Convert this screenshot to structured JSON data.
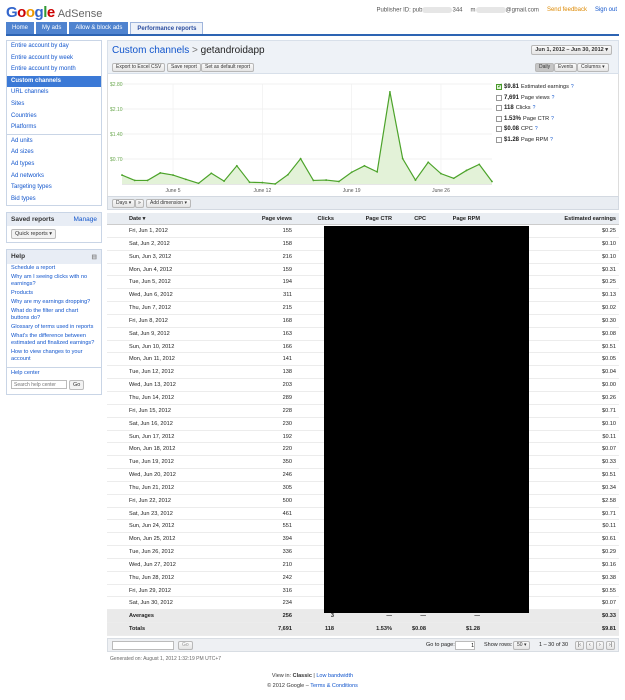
{
  "brand": {
    "g1": "G",
    "g2": "o",
    "g3": "o",
    "g4": "g",
    "g5": "l",
    "g6": "e",
    "product": "AdSense"
  },
  "header": {
    "publisher_label": "Publisher ID: pub",
    "publisher_tail": "344",
    "email_head": "m",
    "email_tail": "@gmail.com",
    "feedback": "Send feedback",
    "signout": "Sign out"
  },
  "nav": {
    "tabs": [
      "Home",
      "My ads",
      "Allow & block ads",
      "Performance reports"
    ]
  },
  "sidebar": {
    "items": [
      "Entire account by day",
      "Entire account by week",
      "Entire account by month",
      "Custom channels",
      "URL channels",
      "Sites",
      "Countries",
      "Platforms",
      "Ad units",
      "Ad sizes",
      "Ad types",
      "Ad networks",
      "Targeting types",
      "Bid types"
    ],
    "saved_title": "Saved reports",
    "saved_manage": "Manage",
    "quick_reports": "Quick reports ▾",
    "help_title": "Help",
    "help_items": [
      "Schedule a report",
      "Why am I seeing clicks with no earnings?",
      "Products",
      "Why are my earnings dropping?",
      "What do the filter and chart buttons do?",
      "Glossary of terms used in reports",
      "What's the difference between estimated and finalized earnings?",
      "How to view changes to your account"
    ],
    "help_center": "Help center",
    "search_placeholder": "Search help center",
    "go": "Go"
  },
  "main": {
    "title_link": "Custom channels",
    "title_sep": ">",
    "title_current": "getandroidapp",
    "date_range": "Jun 1, 2012 – Jun 30, 2012 ▾",
    "buttons": [
      "Export to Excel CSV",
      "Save report",
      "Set as default report"
    ],
    "view_buttons": [
      "Daily",
      "Events",
      "Columns ▾"
    ]
  },
  "legend": [
    {
      "value": "$9.81",
      "label": "Estimated earnings",
      "checked": true
    },
    {
      "value": "7,691",
      "label": "Page views",
      "checked": false
    },
    {
      "value": "118",
      "label": "Clicks",
      "checked": false
    },
    {
      "value": "1.53%",
      "label": "Page CTR",
      "checked": false
    },
    {
      "value": "$0.08",
      "label": "CPC",
      "checked": false
    },
    {
      "value": "$1.28",
      "label": "Page RPM",
      "checked": false
    }
  ],
  "toolbar": {
    "days": "Days ▾",
    "add_dimension": "Add dimension ▾"
  },
  "table": {
    "headers": [
      "Date ▾",
      "Page views",
      "Clicks",
      "Page CTR",
      "CPC",
      "Page RPM",
      "Estimated earnings"
    ],
    "rows": [
      [
        "Fri, Jun 1, 2012",
        "155",
        "$0.25"
      ],
      [
        "Sat, Jun 2, 2012",
        "158",
        "$0.10"
      ],
      [
        "Sun, Jun 3, 2012",
        "216",
        "$0.10"
      ],
      [
        "Mon, Jun 4, 2012",
        "159",
        "$0.31"
      ],
      [
        "Tue, Jun 5, 2012",
        "194",
        "$0.25"
      ],
      [
        "Wed, Jun 6, 2012",
        "311",
        "$0.13"
      ],
      [
        "Thu, Jun 7, 2012",
        "215",
        "$0.02"
      ],
      [
        "Fri, Jun 8, 2012",
        "168",
        "$0.30"
      ],
      [
        "Sat, Jun 9, 2012",
        "163",
        "$0.08"
      ],
      [
        "Sun, Jun 10, 2012",
        "166",
        "$0.51"
      ],
      [
        "Mon, Jun 11, 2012",
        "141",
        "$0.05"
      ],
      [
        "Tue, Jun 12, 2012",
        "138",
        "$0.04"
      ],
      [
        "Wed, Jun 13, 2012",
        "203",
        "$0.00"
      ],
      [
        "Thu, Jun 14, 2012",
        "289",
        "$0.26"
      ],
      [
        "Fri, Jun 15, 2012",
        "228",
        "$0.71"
      ],
      [
        "Sat, Jun 16, 2012",
        "230",
        "$0.10"
      ],
      [
        "Sun, Jun 17, 2012",
        "192",
        "$0.11"
      ],
      [
        "Mon, Jun 18, 2012",
        "220",
        "$0.07"
      ],
      [
        "Tue, Jun 19, 2012",
        "350",
        "$0.33"
      ],
      [
        "Wed, Jun 20, 2012",
        "246",
        "$0.51"
      ],
      [
        "Thu, Jun 21, 2012",
        "305",
        "$0.34"
      ],
      [
        "Fri, Jun 22, 2012",
        "500",
        "$2.58"
      ],
      [
        "Sat, Jun 23, 2012",
        "461",
        "$0.71"
      ],
      [
        "Sun, Jun 24, 2012",
        "551",
        "$0.11"
      ],
      [
        "Mon, Jun 25, 2012",
        "394",
        "$0.61"
      ],
      [
        "Tue, Jun 26, 2012",
        "336",
        "$0.29"
      ],
      [
        "Wed, Jun 27, 2012",
        "210",
        "$0.16"
      ],
      [
        "Thu, Jun 28, 2012",
        "242",
        "$0.38"
      ],
      [
        "Fri, Jun 29, 2012",
        "316",
        "$0.55"
      ],
      [
        "Sat, Jun 30, 2012",
        "234",
        "$0.07"
      ]
    ],
    "averages": {
      "label": "Averages",
      "page_views": "256",
      "clicks": "3",
      "ctr": "—",
      "cpc": "—",
      "rpm": "—",
      "earnings": "$0.33"
    },
    "totals": {
      "label": "Totals",
      "page_views": "7,691",
      "clicks": "118",
      "ctr": "1.53%",
      "cpc": "$0.08",
      "rpm": "$1.28",
      "earnings": "$9.81"
    }
  },
  "pager": {
    "go": "Go",
    "goto_label": "Go to page:",
    "goto_value": "1",
    "show_rows": "Show rows:",
    "rows_value": "50 ▾",
    "range": "1 – 30 of 30"
  },
  "generated": "Generated on: August 1, 2012 1:32:19 PM UTC+7",
  "footer": {
    "view_in": "View in:",
    "classic": "Classic",
    "sep": "|",
    "low_bandwidth": "Low bandwidth",
    "copyright": "© 2012 Google –",
    "terms": "Terms & Conditions"
  },
  "colors": {
    "nav_blue": "#4f83cf",
    "line_green": "#4ca32a",
    "area_green": "#e3f2d8",
    "link": "#1155cc"
  },
  "chart_data": {
    "type": "line",
    "title": "",
    "x": [
      "Jun 1",
      "Jun 2",
      "Jun 3",
      "Jun 4",
      "Jun 5",
      "Jun 6",
      "Jun 7",
      "Jun 8",
      "Jun 9",
      "Jun 10",
      "Jun 11",
      "Jun 12",
      "Jun 13",
      "Jun 14",
      "Jun 15",
      "Jun 16",
      "Jun 17",
      "Jun 18",
      "Jun 19",
      "Jun 20",
      "Jun 21",
      "Jun 22",
      "Jun 23",
      "Jun 24",
      "Jun 25",
      "Jun 26",
      "Jun 27",
      "Jun 28",
      "Jun 29",
      "Jun 30"
    ],
    "series": [
      {
        "name": "Estimated earnings",
        "values": [
          0.25,
          0.1,
          0.1,
          0.31,
          0.25,
          0.13,
          0.02,
          0.3,
          0.08,
          0.51,
          0.05,
          0.04,
          0.0,
          0.26,
          0.71,
          0.1,
          0.11,
          0.07,
          0.33,
          0.51,
          0.34,
          2.58,
          0.71,
          0.11,
          0.61,
          0.29,
          0.16,
          0.38,
          0.55,
          0.07
        ]
      }
    ],
    "y_ticks": [
      "$2.80",
      "$2.10",
      "$1.40",
      "$0.70"
    ],
    "x_ticks": [
      "June 5",
      "June 12",
      "June 19",
      "June 26"
    ],
    "ylim": [
      0,
      2.8
    ],
    "xlabel": "",
    "ylabel": "",
    "grid": true
  }
}
